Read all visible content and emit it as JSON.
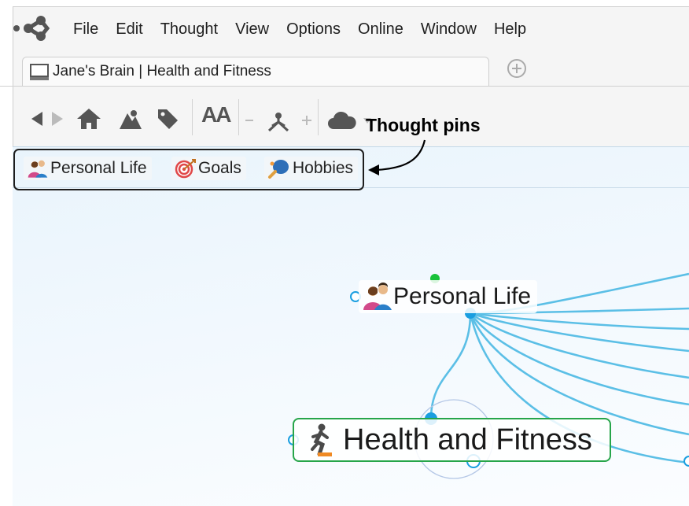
{
  "menu": [
    "File",
    "Edit",
    "Thought",
    "View",
    "Options",
    "Online",
    "Window",
    "Help"
  ],
  "tab": {
    "title": "Jane's Brain | Health and Fitness"
  },
  "toolbar": {
    "font_size_icon": "AA"
  },
  "annotation": {
    "label": "Thought pins"
  },
  "pins": [
    {
      "label": "Personal Life",
      "icon": "couple-icon"
    },
    {
      "label": "Goals",
      "icon": "target-icon"
    },
    {
      "label": "Hobbies",
      "icon": "ping-pong-icon"
    }
  ],
  "thoughts": {
    "parent": {
      "label": "Personal Life",
      "icon": "couple-icon"
    },
    "active": {
      "label": "Health and Fitness",
      "icon": "running-person-icon"
    }
  },
  "colors": {
    "link": "#5bbfe6",
    "gate": "#1a9ee0",
    "active_border": "#27a54a",
    "parent_gate": "#18c23a"
  }
}
